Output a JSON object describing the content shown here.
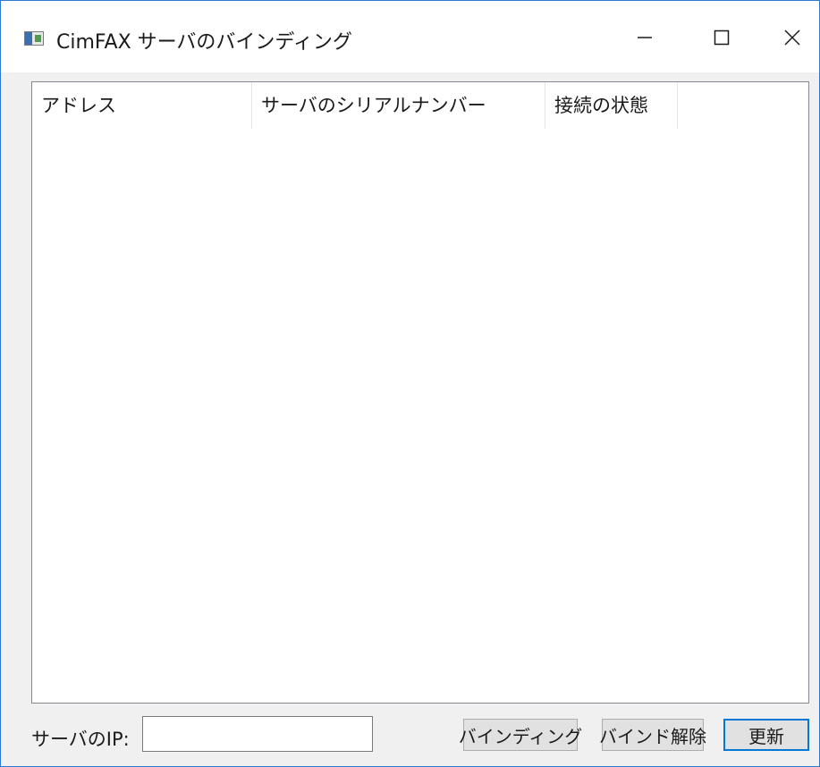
{
  "window": {
    "title": "CimFAX サーバのバインディング",
    "minimize_icon": "minimize-icon",
    "maximize_icon": "maximize-icon",
    "close_icon": "close-icon",
    "accent_color": "#2b79d0"
  },
  "list": {
    "columns": [
      {
        "label": "アドレス"
      },
      {
        "label": "サーバのシリアルナンバー"
      },
      {
        "label": "接続の状態"
      }
    ],
    "rows": []
  },
  "footer": {
    "ip_label": "サーバのIP:",
    "ip_value": "",
    "bind_button": "バインディング",
    "unbind_button": "バインド解除",
    "refresh_button": "更新"
  }
}
